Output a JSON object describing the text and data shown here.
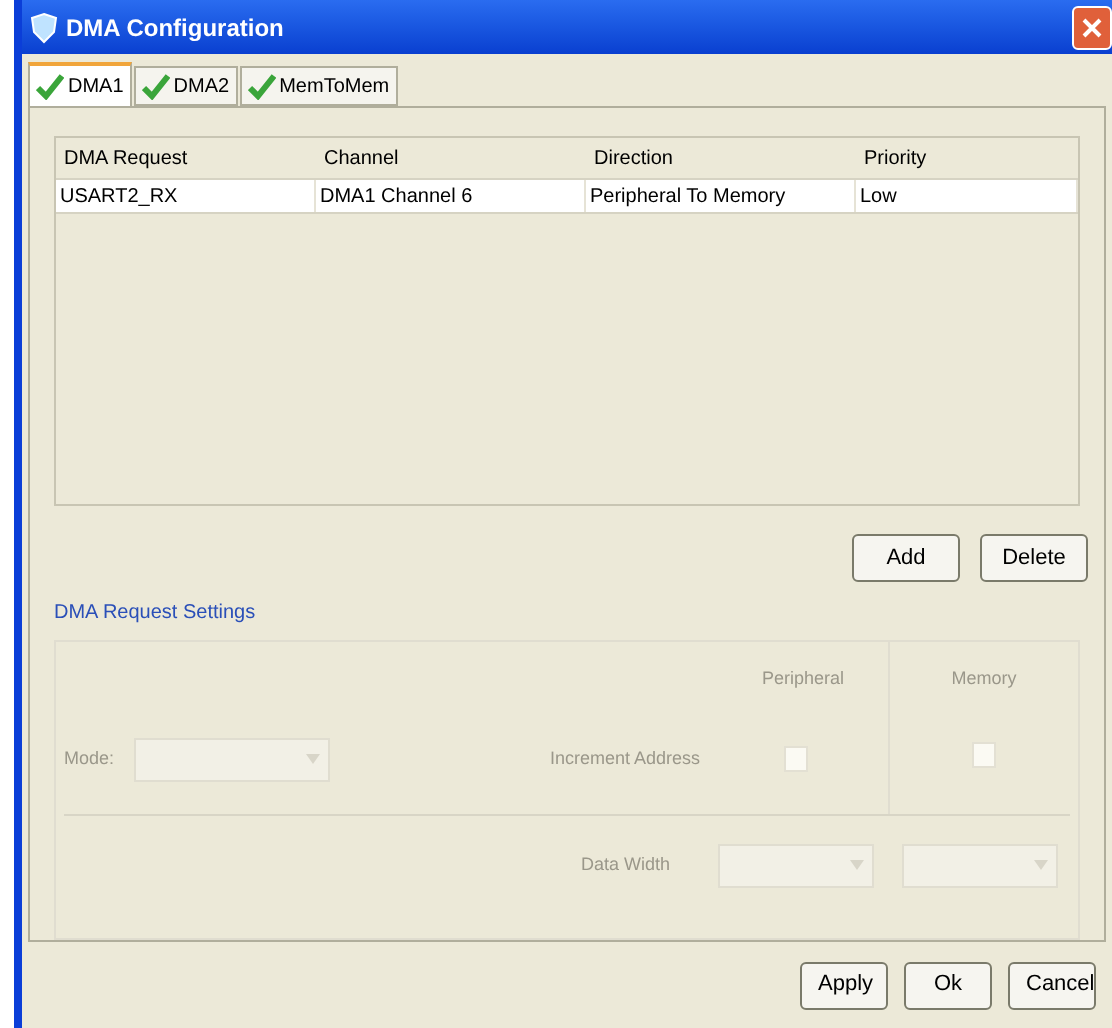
{
  "window": {
    "title": "DMA Configuration"
  },
  "tabs": [
    {
      "label": "DMA1",
      "selected": true,
      "checked": true
    },
    {
      "label": "DMA2",
      "selected": false,
      "checked": true
    },
    {
      "label": "MemToMem",
      "selected": false,
      "checked": true
    }
  ],
  "table": {
    "columns": [
      "DMA Request",
      "Channel",
      "Direction",
      "Priority"
    ],
    "rows": [
      {
        "cells": [
          "USART2_RX",
          "DMA1 Channel 6",
          "Peripheral To Memory",
          "Low"
        ],
        "selected": false
      }
    ]
  },
  "table_buttons": [
    "Add",
    "Delete"
  ],
  "settings": {
    "title": "DMA Request Settings",
    "mode_label": "Mode:",
    "peripheral_header": "Peripheral",
    "memory_header": "Memory",
    "increment_label": "Increment Address",
    "peripheral_increment": false,
    "memory_increment": false,
    "data_width_label": "Data Width",
    "disabled": true
  },
  "buttons": [
    "Apply",
    "Ok",
    "Cancel"
  ]
}
